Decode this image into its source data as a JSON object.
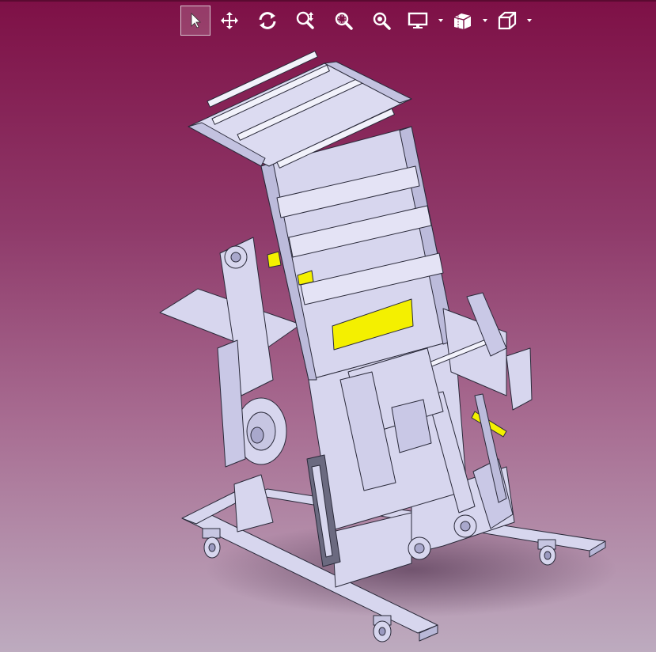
{
  "window": {
    "background_top": "#7e1046",
    "background_bottom": "#bdabbf"
  },
  "toolbar": {
    "tools": [
      {
        "name": "select",
        "icon": "arrow-pointer-icon",
        "active": true
      },
      {
        "name": "pan",
        "icon": "move-arrows-icon",
        "active": false
      },
      {
        "name": "rotate",
        "icon": "rotate-icon",
        "active": false
      },
      {
        "name": "zoom-in-out",
        "icon": "zoom-in-out-icon",
        "active": false
      },
      {
        "name": "zoom-area",
        "icon": "zoom-area-icon",
        "active": false
      },
      {
        "name": "zoom-to-fit",
        "icon": "zoom-fit-icon",
        "active": false
      },
      {
        "name": "display-style",
        "icon": "monitor-icon",
        "dropdown": true
      },
      {
        "name": "section-view",
        "icon": "section-view-icon",
        "dropdown": true
      },
      {
        "name": "view-orientation",
        "icon": "cube-view-icon",
        "dropdown": true
      }
    ]
  },
  "model": {
    "description_icon": "machine-assembly-3d",
    "body_color": "#d7d6ee",
    "edge_color": "#2a2a3a",
    "highlight_color": "#f4f000"
  }
}
